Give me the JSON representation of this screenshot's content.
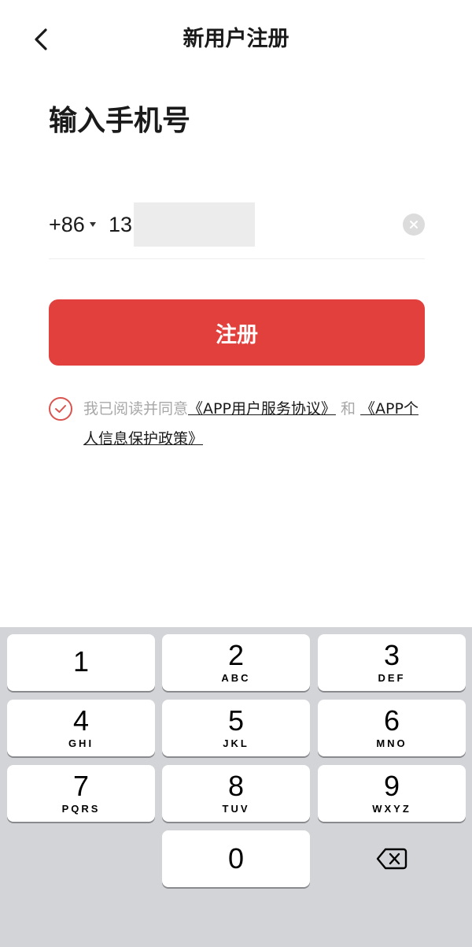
{
  "nav": {
    "title": "新用户注册",
    "back_icon": "chevron-left-icon"
  },
  "heading": "输入手机号",
  "phone": {
    "country_code": "+86",
    "value_prefix": "13",
    "clear_icon": "clear-circle-icon"
  },
  "register_button": {
    "label": "注册"
  },
  "agreement": {
    "checked": true,
    "prefix_text": "我已阅读并同意",
    "link1": "《APP用户服务协议》",
    "joiner": "和",
    "link2": "《APP个人信息保护政策》"
  },
  "keyboard": {
    "keys": [
      {
        "digit": "1",
        "letters": ""
      },
      {
        "digit": "2",
        "letters": "ABC"
      },
      {
        "digit": "3",
        "letters": "DEF"
      },
      {
        "digit": "4",
        "letters": "GHI"
      },
      {
        "digit": "5",
        "letters": "JKL"
      },
      {
        "digit": "6",
        "letters": "MNO"
      },
      {
        "digit": "7",
        "letters": "PQRS"
      },
      {
        "digit": "8",
        "letters": "TUV"
      },
      {
        "digit": "9",
        "letters": "WXYZ"
      },
      {
        "digit": "0",
        "letters": ""
      }
    ],
    "delete_icon": "backspace-icon"
  },
  "colors": {
    "accent": "#e2403d",
    "keyboard_bg": "#d3d4d8"
  }
}
